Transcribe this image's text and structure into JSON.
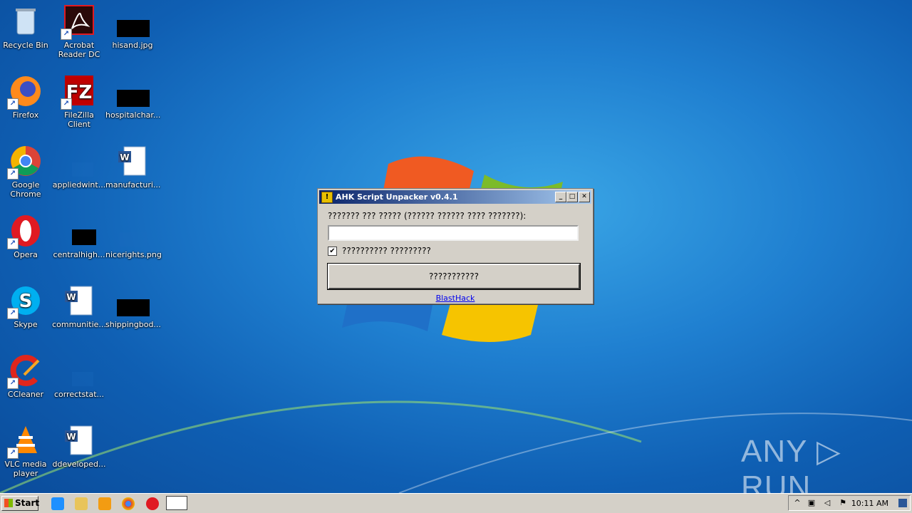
{
  "desktop_icons": [
    {
      "label": "Recycle Bin"
    },
    {
      "label": "Acrobat Reader DC"
    },
    {
      "label": "hisand.jpg"
    },
    {
      "label": "Firefox"
    },
    {
      "label": "FileZilla Client"
    },
    {
      "label": "hospitalchar..."
    },
    {
      "label": "Google Chrome"
    },
    {
      "label": "appliedwint..."
    },
    {
      "label": "manufacturi..."
    },
    {
      "label": "Opera"
    },
    {
      "label": "centralhigh..."
    },
    {
      "label": "nicerights.png"
    },
    {
      "label": "Skype"
    },
    {
      "label": "communitie..."
    },
    {
      "label": "shippingbod..."
    },
    {
      "label": "CCleaner"
    },
    {
      "label": "correctstat..."
    },
    {
      "label": "VLC media player"
    },
    {
      "label": "ddeveloped..."
    }
  ],
  "dialog": {
    "title": "AHK Script Unpacker v0.4.1",
    "prompt": "??????? ??? ????? (?????? ?????? ???? ???????):",
    "input_value": "",
    "checkbox_label": "?????????? ?????????",
    "checkbox_checked": true,
    "button_label": "???????????",
    "link": "BlastHack"
  },
  "taskbar": {
    "start_label": "Start",
    "clock": "10:11 AM"
  },
  "watermark": "ANY ▷ RUN"
}
